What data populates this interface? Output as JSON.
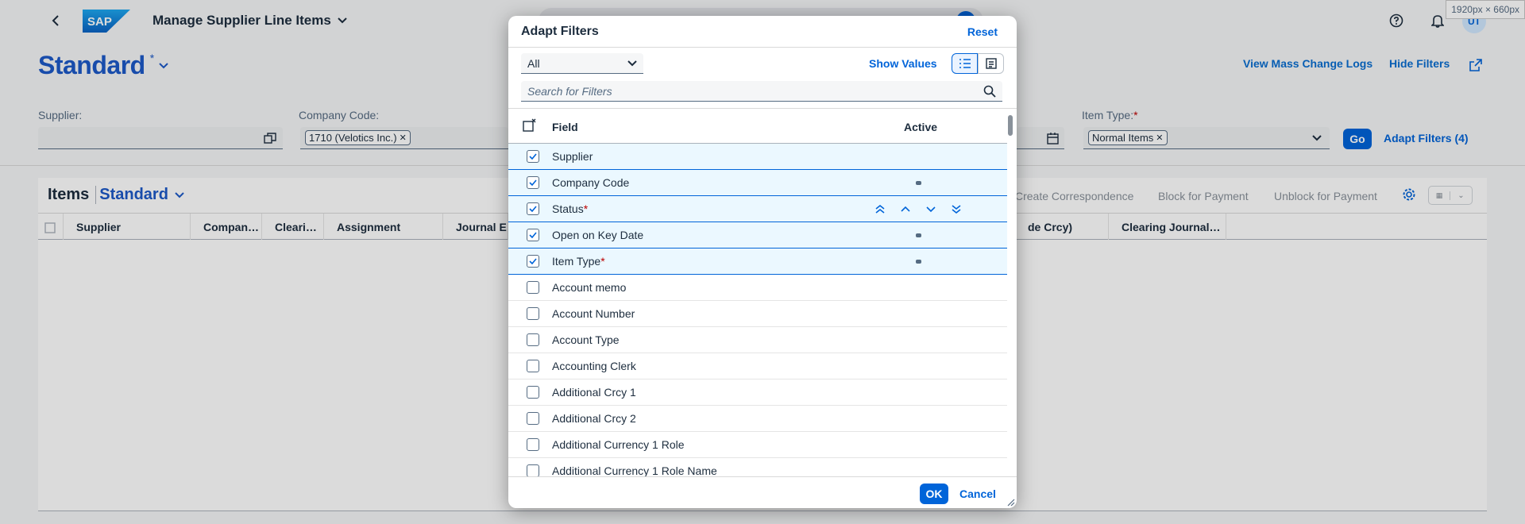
{
  "shell": {
    "app_title": "Manage Supplier Line Items",
    "logo_text": "SAP",
    "avatar_initials": "UT",
    "dimension_badge": "1920px × 660px"
  },
  "variant": {
    "title": "Standard",
    "modified_marker": "*"
  },
  "header_actions": {
    "view_mass_change_logs": "View Mass Change Logs",
    "hide_filters": "Hide Filters"
  },
  "filter_bar": {
    "supplier_label": "Supplier:",
    "company_code_label": "Company Code:",
    "company_code_token": "1710 (Velotics Inc.)",
    "item_type_label": "Item Type:",
    "item_type_required": "*",
    "item_type_token": "Normal Items",
    "go_label": "Go",
    "adapt_filters_label": "Adapt Filters (4)"
  },
  "table": {
    "title": "Items",
    "variant": "Standard",
    "toolbar": {
      "create_correspondence": "Create Correspondence",
      "block_for_payment": "Block for Payment",
      "unblock_for_payment": "Unblock for Payment"
    },
    "columns": [
      "Supplier",
      "Compan…",
      "Cleari…",
      "Assignment",
      "Journal E",
      "de Crcy)",
      "Clearing Journal…"
    ]
  },
  "dialog": {
    "title": "Adapt Filters",
    "reset_label": "Reset",
    "select_value": "All",
    "show_values_label": "Show Values",
    "search_placeholder": "Search for Filters",
    "col_field": "Field",
    "col_active": "Active",
    "rows": [
      {
        "label": "Supplier",
        "checked": true,
        "required": false,
        "active": false
      },
      {
        "label": "Company Code",
        "checked": true,
        "required": false,
        "active": true
      },
      {
        "label": "Status",
        "checked": true,
        "required": true,
        "active": false
      },
      {
        "label": "Open on Key Date",
        "checked": true,
        "required": false,
        "active": true
      },
      {
        "label": "Item Type",
        "checked": true,
        "required": true,
        "active": true
      },
      {
        "label": "Account memo",
        "checked": false,
        "required": false,
        "active": false
      },
      {
        "label": "Account Number",
        "checked": false,
        "required": false,
        "active": false
      },
      {
        "label": "Account Type",
        "checked": false,
        "required": false,
        "active": false
      },
      {
        "label": "Accounting Clerk",
        "checked": false,
        "required": false,
        "active": false
      },
      {
        "label": "Additional Crcy 1",
        "checked": false,
        "required": false,
        "active": false
      },
      {
        "label": "Additional Crcy 2",
        "checked": false,
        "required": false,
        "active": false
      },
      {
        "label": "Additional Currency 1 Role",
        "checked": false,
        "required": false,
        "active": false
      },
      {
        "label": "Additional Currency 1 Role Name",
        "checked": false,
        "required": false,
        "active": false
      }
    ],
    "ok_label": "OK",
    "cancel_label": "Cancel"
  },
  "colors": {
    "brand_blue": "#0064d9",
    "title_blue": "#1c59c8",
    "required_red": "#bb0000",
    "selected_row_bg": "#ebf8ff"
  }
}
